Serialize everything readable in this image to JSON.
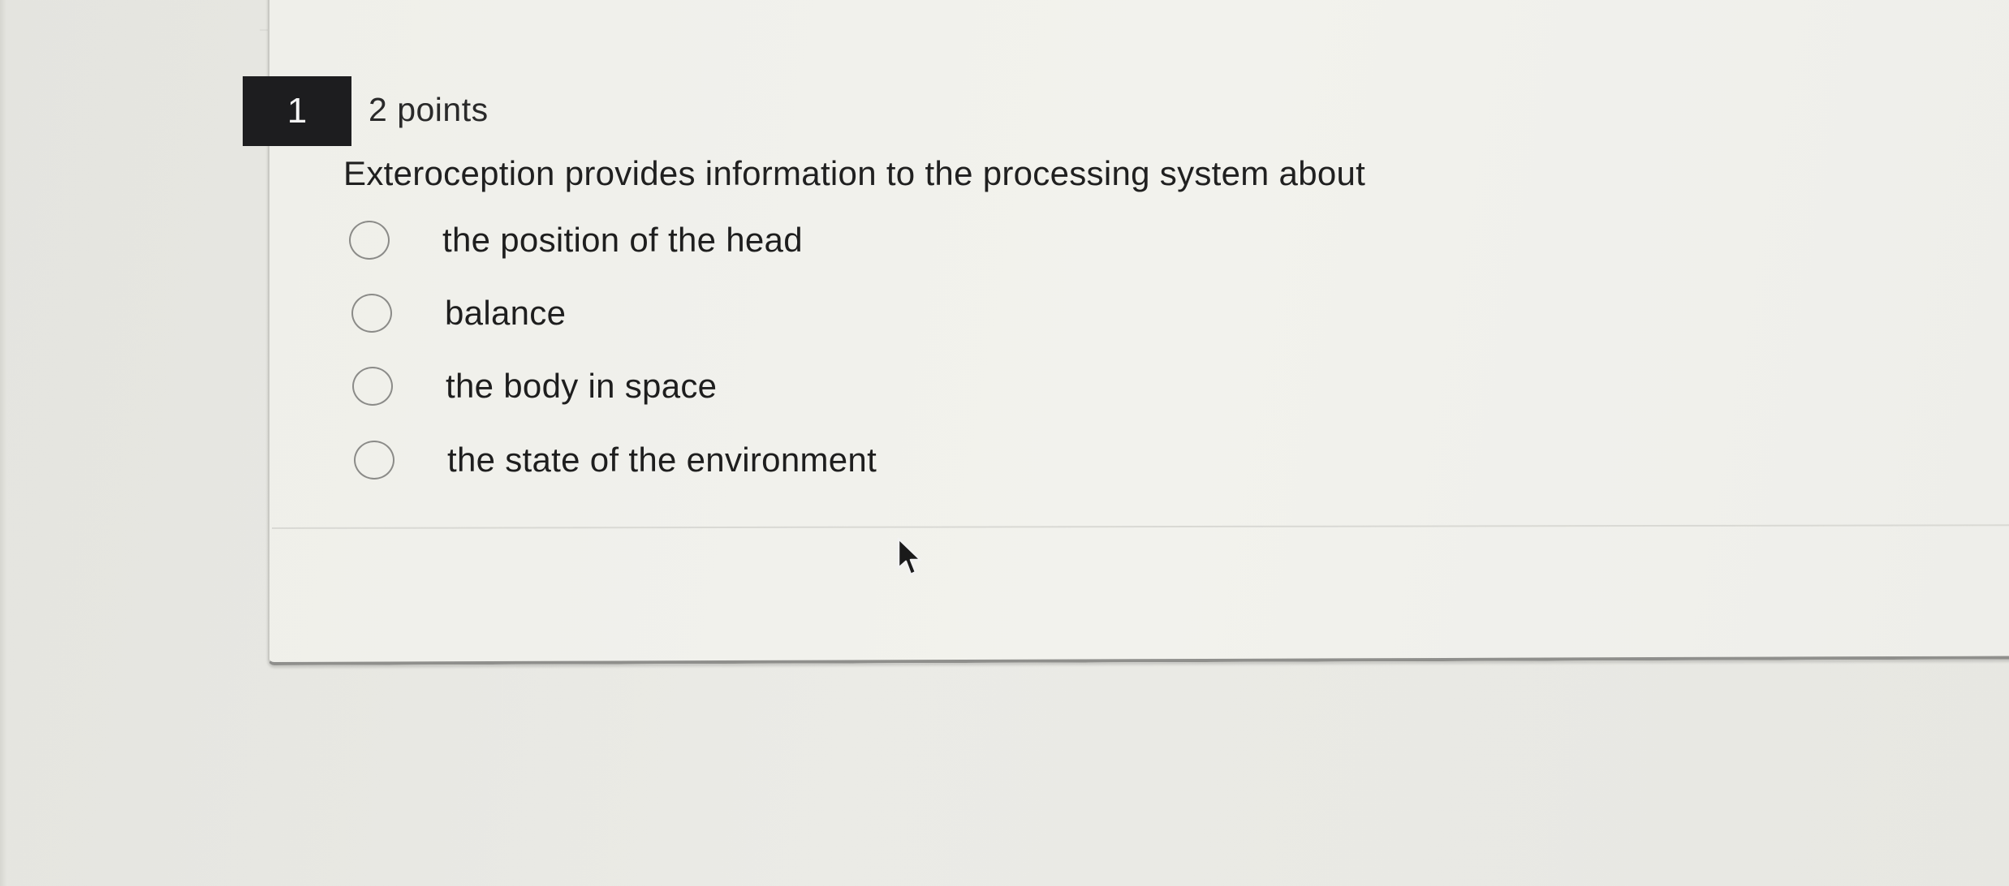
{
  "question": {
    "number": "1",
    "points": "2 points",
    "text": "Exteroception provides information to the processing system about",
    "options": [
      {
        "label": "the position of the head",
        "selected": false
      },
      {
        "label": "balance",
        "selected": false
      },
      {
        "label": "the body in space",
        "selected": false
      },
      {
        "label": "the state of the environment",
        "selected": false
      }
    ]
  },
  "colors": {
    "number_badge_bg": "#1d1d1f",
    "number_badge_text": "#f4f4f4",
    "card_bg": "#f0f0eb",
    "radio_border": "#8b8b88"
  },
  "icons": {
    "cursor": "mouse-pointer-arrow-icon"
  }
}
